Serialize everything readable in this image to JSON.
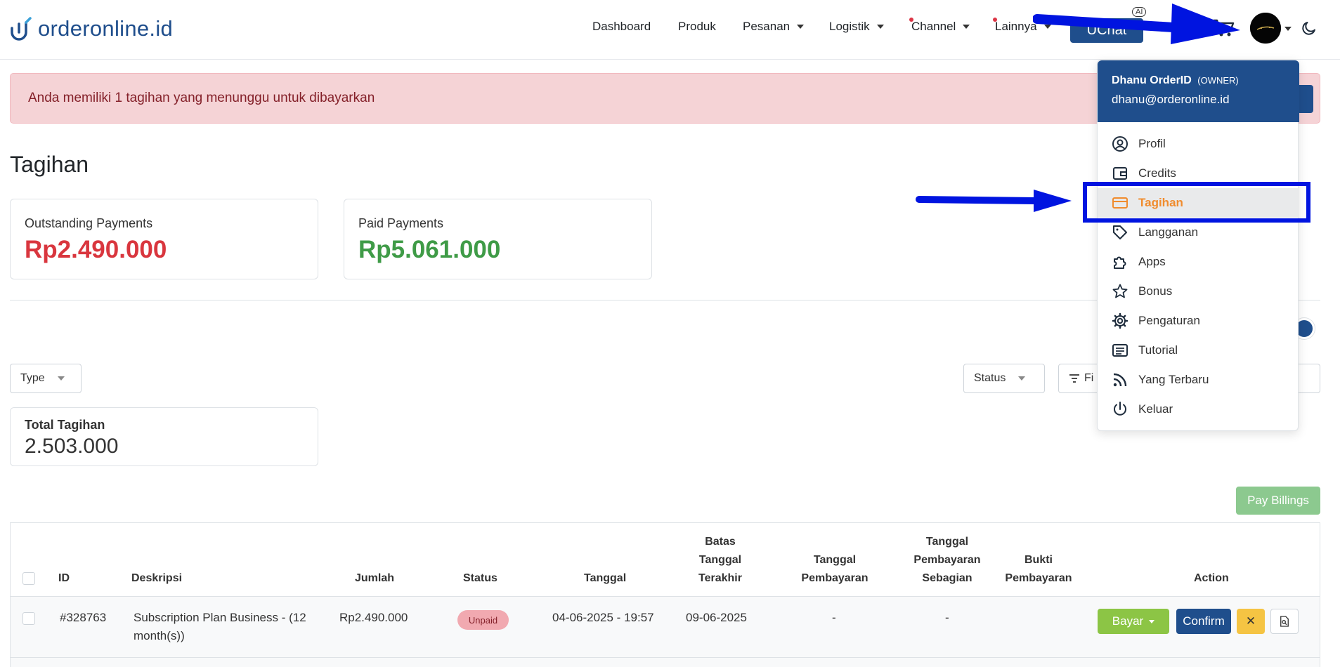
{
  "navbar": {
    "brand": "orderonline.id",
    "items": [
      {
        "label": "Dashboard",
        "dropdown": false,
        "dot": false
      },
      {
        "label": "Produk",
        "dropdown": false,
        "dot": false
      },
      {
        "label": "Pesanan",
        "dropdown": true,
        "dot": false
      },
      {
        "label": "Logistik",
        "dropdown": true,
        "dot": false
      },
      {
        "label": "Channel",
        "dropdown": true,
        "dot": true
      },
      {
        "label": "Lainnya",
        "dropdown": true,
        "dot": true
      }
    ],
    "uchat_label": "UChat",
    "ai_badge": "AI",
    "icons": [
      "cart-icon",
      "avatar",
      "moon-icon"
    ]
  },
  "alert": {
    "text": "Anda memiliki 1 tagihan yang menunggu untuk dibayarkan"
  },
  "page": {
    "title": "Tagihan"
  },
  "summary": {
    "outstanding_label": "Outstanding Payments",
    "outstanding_amount": "Rp2.490.000",
    "paid_label": "Paid Payments",
    "paid_amount": "Rp5.061.000"
  },
  "filters": {
    "type_label": "Type",
    "status_label": "Status",
    "filter_label": "Fi"
  },
  "total": {
    "label": "Total Tagihan",
    "value": "2.503.000"
  },
  "pay_billings_label": "Pay Billings",
  "table": {
    "headers": {
      "id": "ID",
      "deskripsi": "Deskripsi",
      "jumlah": "Jumlah",
      "status": "Status",
      "tanggal": "Tanggal",
      "batas_1": "Batas",
      "batas_2": "Tanggal",
      "batas_3": "Terakhir",
      "tp_1": "Tanggal",
      "tp_2": "Pembayaran",
      "tps_1": "Tanggal",
      "tps_2": "Pembayaran",
      "tps_3": "Sebagian",
      "bukti_1": "Bukti",
      "bukti_2": "Pembayaran",
      "action": "Action"
    },
    "rows": [
      {
        "id": "#328763",
        "desc_1": "Subscription Plan Business - (12",
        "desc_2": "month(s))",
        "jumlah": "Rp2.490.000",
        "status": "Unpaid",
        "tanggal": "04-06-2025 - 19:57",
        "batas": "09-06-2025",
        "tanggal_pembayaran": "-",
        "tanggal_pembayaran_sebagian": "-",
        "bayar_label": "Bayar",
        "confirm_label": "Confirm",
        "cancel_label": "✕"
      }
    ]
  },
  "user_menu": {
    "name": "Dhanu OrderID",
    "role": "(OWNER)",
    "email": "dhanu@orderonline.id",
    "items": [
      {
        "label": "Profil",
        "icon": "user-circle-icon"
      },
      {
        "label": "Credits",
        "icon": "wallet-icon"
      },
      {
        "label": "Tagihan",
        "icon": "credit-card-icon",
        "active": true
      },
      {
        "label": "Langganan",
        "icon": "tag-icon"
      },
      {
        "label": "Apps",
        "icon": "puzzle-icon"
      },
      {
        "label": "Bonus",
        "icon": "star-icon"
      },
      {
        "label": "Pengaturan",
        "icon": "gear-icon"
      },
      {
        "label": "Tutorial",
        "icon": "list-icon"
      },
      {
        "label": "Yang Terbaru",
        "icon": "rss-icon"
      },
      {
        "label": "Keluar",
        "icon": "power-icon"
      }
    ]
  },
  "colors": {
    "brand": "#1f4e8c",
    "outstanding": "#d9363e",
    "paid": "#3f9b47",
    "active_menu": "#f08c2e",
    "annotation": "#0014e0"
  }
}
